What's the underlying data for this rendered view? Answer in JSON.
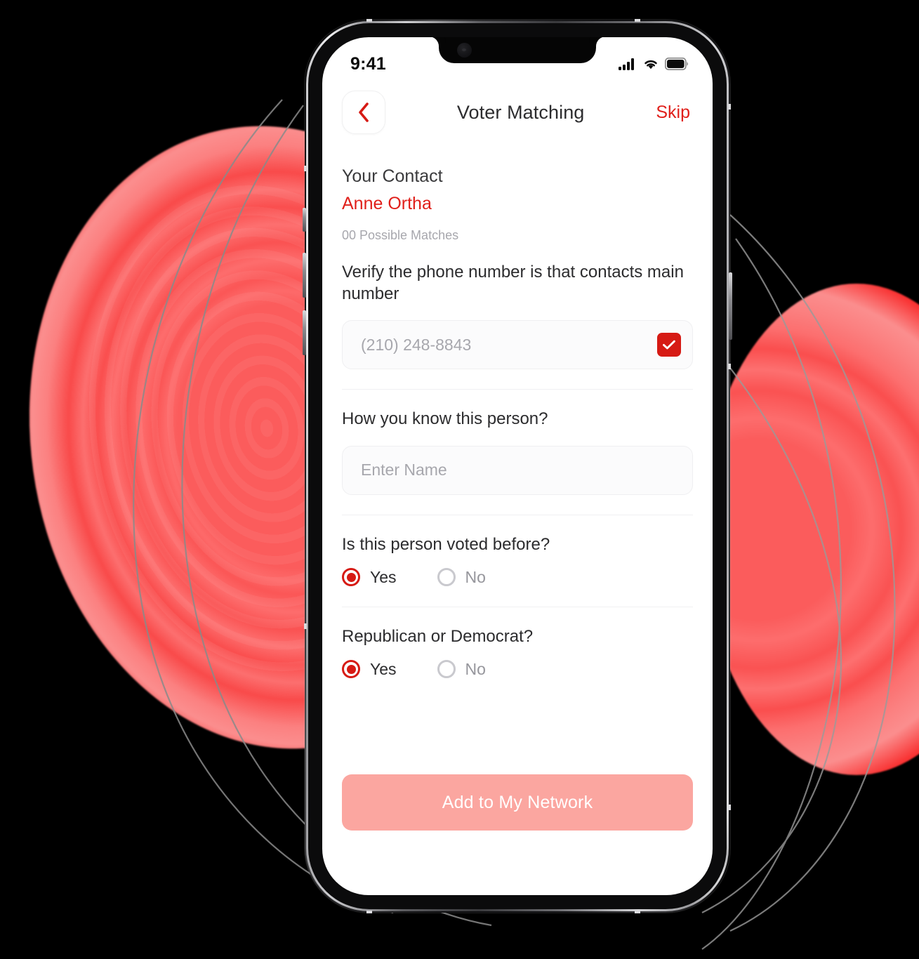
{
  "colors": {
    "accent_red": "#e01f1a",
    "checkbox_red": "#d61a14",
    "cta_pink": "#fba6a0",
    "page_bg": "#000000",
    "screen_bg": "#ffffff",
    "muted_text": "#a7a7ad",
    "heading_text": "#2c2c2e"
  },
  "status_bar": {
    "time": "9:41",
    "cellular_icon": "cellular-bars-icon",
    "wifi_icon": "wifi-icon",
    "battery_icon": "battery-full-icon"
  },
  "nav": {
    "back_icon": "chevron-left-icon",
    "title": "Voter Matching",
    "skip_label": "Skip"
  },
  "contact": {
    "section_label": "Your Contact",
    "name": "Anne Ortha",
    "matches_text": "00 Possible Matches"
  },
  "phone_verify": {
    "question": "Verify the phone number is that contacts main number",
    "value": "(210) 248-8843",
    "placeholder": "(210) 248-8843",
    "checkbox_icon": "check-icon",
    "checked": true
  },
  "relationship": {
    "question": "How you know this person?",
    "value": "",
    "placeholder": "Enter Name"
  },
  "questions": [
    {
      "question": "Is this person voted before?",
      "options": [
        {
          "label": "Yes",
          "selected": true
        },
        {
          "label": "No",
          "selected": false
        }
      ]
    },
    {
      "question": "Republican or Democrat?",
      "options": [
        {
          "label": "Yes",
          "selected": true
        },
        {
          "label": "No",
          "selected": false
        }
      ]
    }
  ],
  "cta": {
    "label": "Add to My Network"
  }
}
